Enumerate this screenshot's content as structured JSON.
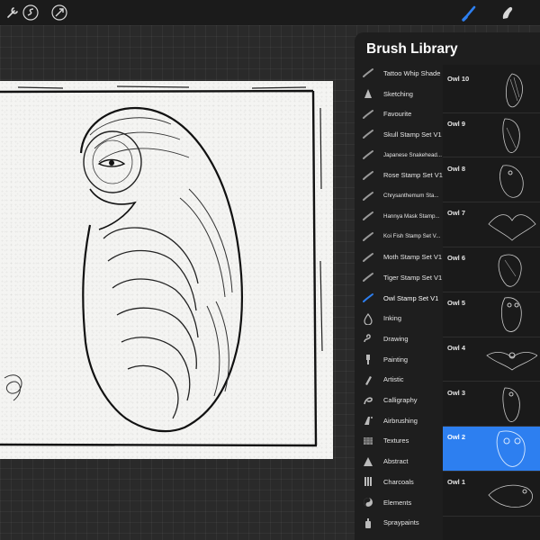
{
  "toolbar": {
    "left_tools": [
      "wrench-icon",
      "magic-wand-icon",
      "selection-icon",
      "transform-arrow-icon"
    ],
    "right_tools": [
      "brush-icon",
      "smudge-icon"
    ],
    "accent_color": "#2d7ff0"
  },
  "brush_library": {
    "title": "Brush Library",
    "categories": [
      {
        "label": "Tattoo Whip Shade",
        "icon": "stroke-icon"
      },
      {
        "label": "Sketching",
        "icon": "pencil-tip-icon"
      },
      {
        "label": "Favourite",
        "icon": "stroke-icon"
      },
      {
        "label": "Skull Stamp Set V1",
        "icon": "stroke-icon"
      },
      {
        "label": "Japanese Snakehead...",
        "icon": "stroke-icon"
      },
      {
        "label": "Rose Stamp Set V1",
        "icon": "stroke-icon"
      },
      {
        "label": "Chrysanthemum Sta...",
        "icon": "stroke-icon"
      },
      {
        "label": "Hannya Mask Stamp...",
        "icon": "stroke-icon"
      },
      {
        "label": "Koi Fish Stamp Set V...",
        "icon": "stroke-icon"
      },
      {
        "label": "Moth Stamp Set V1",
        "icon": "stroke-icon"
      },
      {
        "label": "Tiger Stamp Set V1",
        "icon": "stroke-icon"
      },
      {
        "label": "Owl Stamp Set V1",
        "icon": "stroke-icon",
        "active": true
      },
      {
        "label": "Inking",
        "icon": "ink-drop-icon"
      },
      {
        "label": "Drawing",
        "icon": "squiggle-icon"
      },
      {
        "label": "Painting",
        "icon": "paint-brush-icon"
      },
      {
        "label": "Artistic",
        "icon": "artistic-brush-icon"
      },
      {
        "label": "Calligraphy",
        "icon": "calligraphy-icon"
      },
      {
        "label": "Airbrushing",
        "icon": "airbrush-icon"
      },
      {
        "label": "Textures",
        "icon": "texture-icon"
      },
      {
        "label": "Abstract",
        "icon": "abstract-triangle-icon"
      },
      {
        "label": "Charcoals",
        "icon": "charcoal-icon"
      },
      {
        "label": "Elements",
        "icon": "yin-yang-icon"
      },
      {
        "label": "Spraypaints",
        "icon": "spray-can-icon"
      }
    ],
    "brushes": [
      {
        "label": "Owl 10"
      },
      {
        "label": "Owl 9"
      },
      {
        "label": "Owl 8"
      },
      {
        "label": "Owl 7"
      },
      {
        "label": "Owl 6"
      },
      {
        "label": "Owl 5"
      },
      {
        "label": "Owl 4"
      },
      {
        "label": "Owl 3"
      },
      {
        "label": "Owl 2",
        "selected": true
      },
      {
        "label": "Owl 1"
      }
    ]
  }
}
